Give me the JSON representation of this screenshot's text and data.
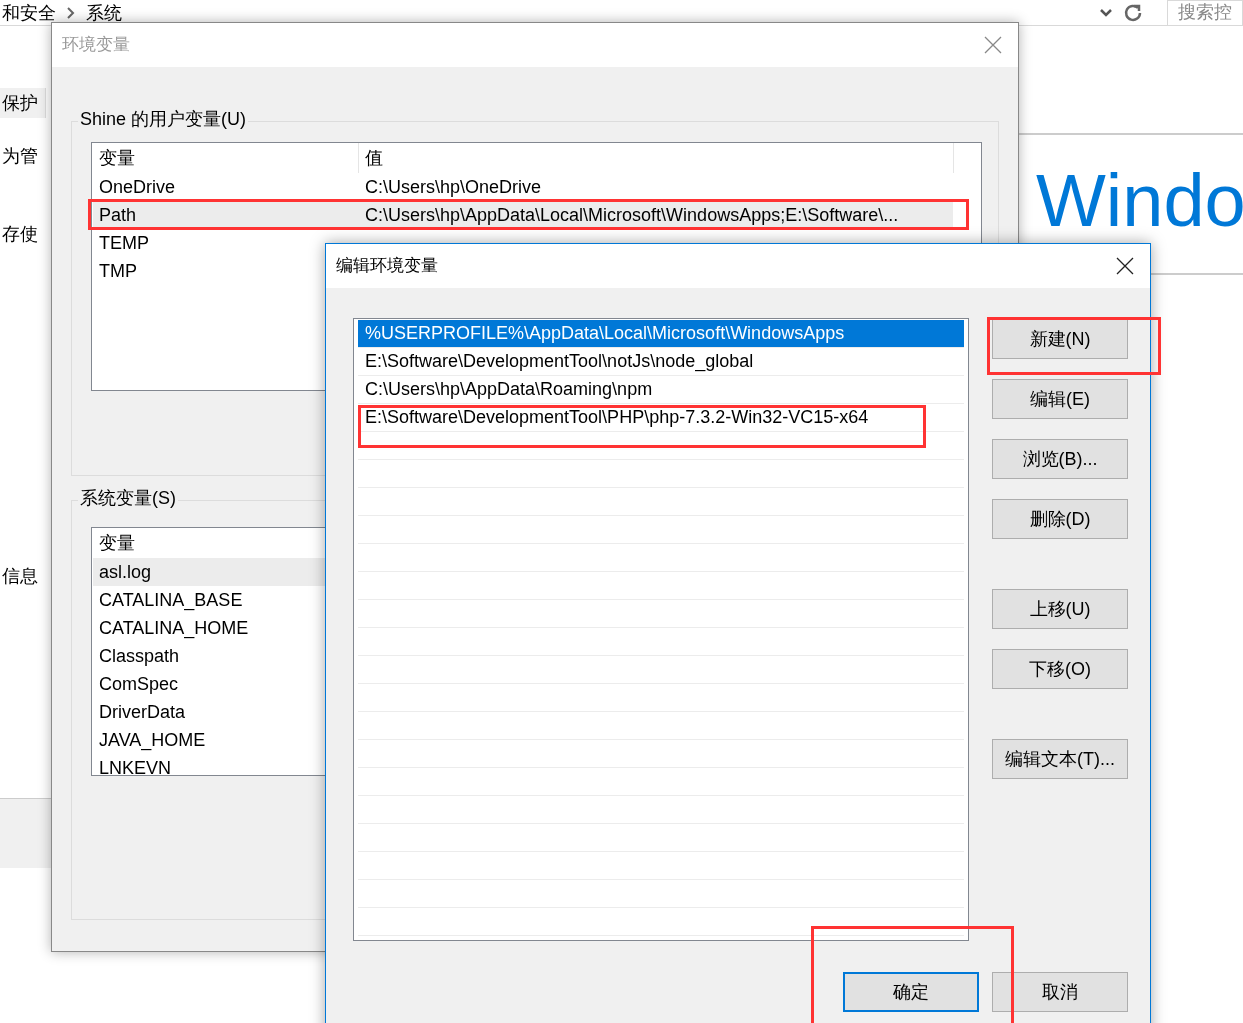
{
  "background": {
    "breadcrumb": [
      "和安全",
      "系统"
    ],
    "search": {
      "placeholder": "搜索控"
    },
    "sidebar_fragments": [
      "保护",
      "为管",
      "存使",
      "信息"
    ],
    "heading": "Windo"
  },
  "env_dialog": {
    "title": "环境变量",
    "user_group": "Shine 的用户变量(U)",
    "user_columns": [
      "变量",
      "值"
    ],
    "user_rows": [
      {
        "name": "OneDrive",
        "value": "C:\\Users\\hp\\OneDrive",
        "selected": false
      },
      {
        "name": "Path",
        "value": "C:\\Users\\hp\\AppData\\Local\\Microsoft\\WindowsApps;E:\\Software\\...",
        "selected": true
      },
      {
        "name": "TEMP",
        "selected": false
      },
      {
        "name": "TMP",
        "selected": false
      }
    ],
    "system_group": "系统变量(S)",
    "system_columns": [
      "变量"
    ],
    "system_rows": [
      {
        "name": "asl.log",
        "selected": true
      },
      {
        "name": "CATALINA_BASE",
        "selected": false
      },
      {
        "name": "CATALINA_HOME",
        "selected": false
      },
      {
        "name": "Classpath",
        "selected": false
      },
      {
        "name": "ComSpec",
        "selected": false
      },
      {
        "name": "DriverData",
        "selected": false
      },
      {
        "name": "JAVA_HOME",
        "selected": false
      },
      {
        "name": "LNKEVN",
        "selected": false
      }
    ]
  },
  "edit_dialog": {
    "title": "编辑环境变量",
    "entries": [
      {
        "text": "%USERPROFILE%\\AppData\\Local\\Microsoft\\WindowsApps",
        "selected": true
      },
      {
        "text": "E:\\Software\\DevelopmentTool\\notJs\\node_global",
        "selected": false
      },
      {
        "text": "C:\\Users\\hp\\AppData\\Roaming\\npm",
        "selected": false
      },
      {
        "text": "E:\\Software\\DevelopmentTool\\PHP\\php-7.3.2-Win32-VC15-x64",
        "selected": false
      }
    ],
    "side_button_groups": [
      [
        "新建(N)",
        "编辑(E)",
        "浏览(B)...",
        "删除(D)"
      ],
      [
        "上移(U)",
        "下移(O)"
      ],
      [
        "编辑文本(T)..."
      ]
    ],
    "footer_buttons": [
      {
        "label": "确定",
        "default": true
      },
      {
        "label": "取消",
        "default": false
      }
    ]
  }
}
